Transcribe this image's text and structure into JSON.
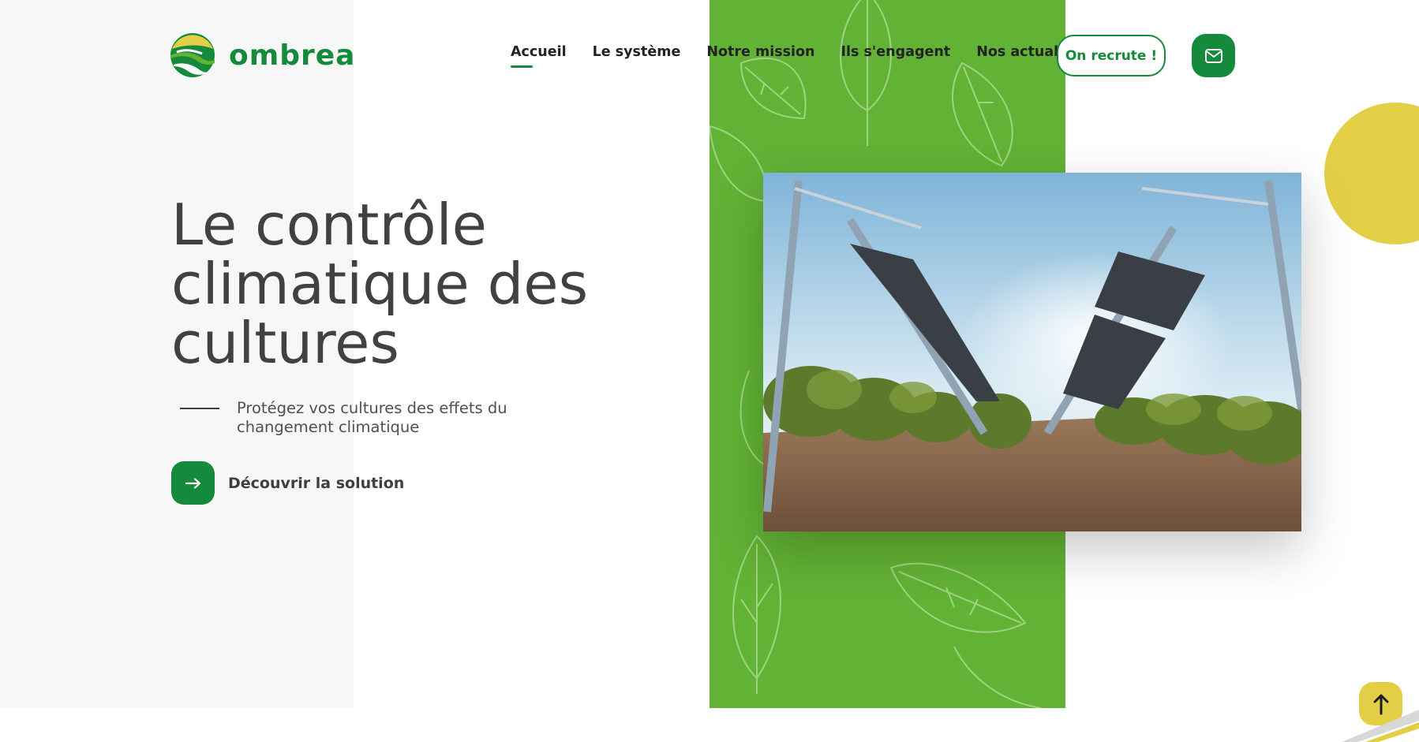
{
  "brand": {
    "name": "ombrea",
    "logo_icon": "ombrea-logo-icon"
  },
  "nav": {
    "items": [
      {
        "label": "Accueil",
        "active": true
      },
      {
        "label": "Le système",
        "active": false
      },
      {
        "label": "Notre mission",
        "active": false
      },
      {
        "label": "Ils s'engagent",
        "active": false
      },
      {
        "label": "Nos actualités",
        "active": false
      }
    ],
    "recruit_label": "On recrute !",
    "contact_icon": "mail-icon"
  },
  "hero": {
    "title_lines": [
      "Le contrôle",
      "climatique des",
      "cultures"
    ],
    "subtitle_lines": [
      "Protégez vos cultures des effets du",
      "changement climatique"
    ],
    "cta_label": "Découvrir la solution",
    "cta_icon": "arrow-right-icon"
  },
  "scroll_top_icon": "arrow-up-icon",
  "colors": {
    "brand_green": "#168a3c",
    "leaf_green": "#62b235",
    "accent_yellow": "#e3cf46",
    "panel_grey": "#f7f7f7"
  }
}
